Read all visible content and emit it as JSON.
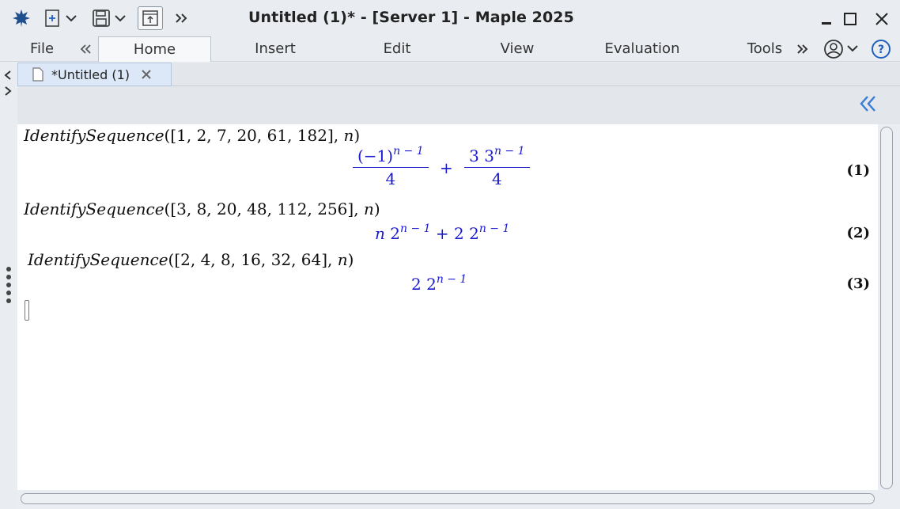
{
  "window": {
    "title": "Untitled (1)* - [Server 1] - Maple 2025"
  },
  "menu": {
    "file": "File",
    "tabs": [
      {
        "label": "Home",
        "active": true
      },
      {
        "label": "Insert"
      },
      {
        "label": "Edit"
      },
      {
        "label": "View"
      },
      {
        "label": "Evaluation"
      },
      {
        "label": "Tools"
      }
    ]
  },
  "document_tab": {
    "label": "*Untitled (1)"
  },
  "worksheet": {
    "inputs": [
      {
        "fn": "IdentifySequence",
        "args": "([1, 2, 7, 20, 61, 182], ",
        "var": "n",
        "close": ")"
      },
      {
        "fn": "IdentifySequence",
        "args": "([3, 8, 20, 48, 112, 256], ",
        "var": "n",
        "close": ")"
      },
      {
        "fn": "IdentifySequence",
        "args": "([2, 4, 8, 16, 32, 64], ",
        "var": "n",
        "close": ")"
      }
    ],
    "outputs": {
      "o1": {
        "num1": "(−1)",
        "exp1": "n − 1",
        "den1": "4",
        "plus": "+",
        "num2": "3 3",
        "exp2": "n − 1",
        "den2": "4",
        "label": "(1)"
      },
      "o2": {
        "a": "n",
        "b": " 2",
        "exp1": "n − 1",
        "plus": " + 2 2",
        "exp2": "n − 1",
        "label": "(2)"
      },
      "o3": {
        "base": "2 2",
        "exp": "n − 1",
        "label": "(3)"
      }
    }
  },
  "colors": {
    "output": "#1a1ad0",
    "accent": "#1f5fbf"
  }
}
